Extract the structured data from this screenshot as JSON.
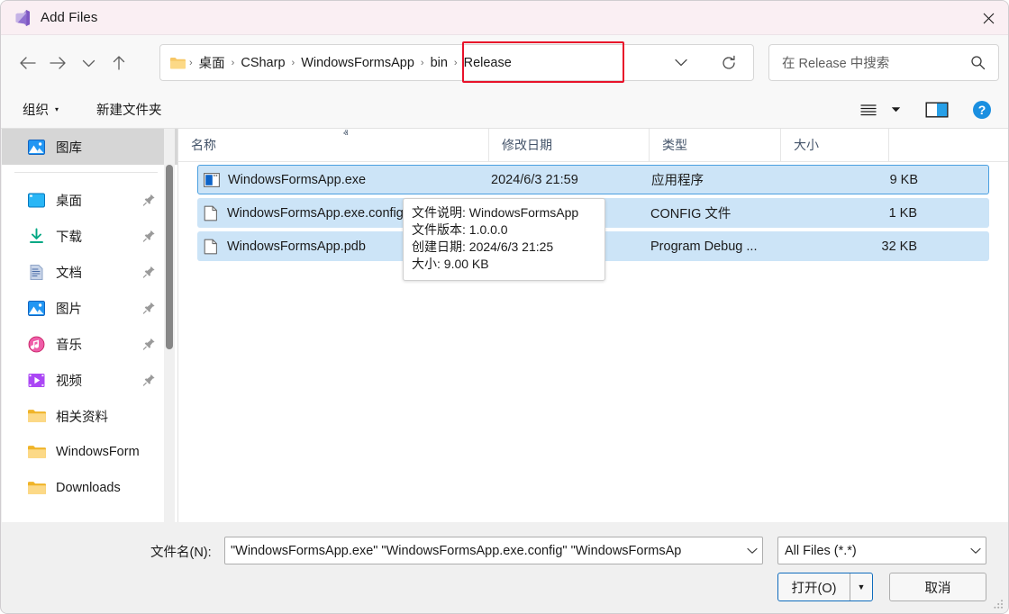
{
  "window": {
    "title": "Add Files",
    "app_icon": "visual-studio-icon",
    "close_label": "✕",
    "titlebar_color": "#faeff3"
  },
  "nav": {
    "back": "back-arrow-icon",
    "forward": "forward-arrow-icon",
    "recent": "chevron-down-icon",
    "up": "up-arrow-icon",
    "refresh": "refresh-icon",
    "dropdown": "chevron-down-icon"
  },
  "breadcrumb": {
    "folder_icon": "folder-icon",
    "separator": "›",
    "items": [
      "桌面",
      "CSharp",
      "WindowsFormsApp",
      "bin",
      "Release"
    ],
    "highlight_color": "#e8122a",
    "highlighted_items": [
      "bin",
      "Release"
    ]
  },
  "search": {
    "placeholder": "在 Release 中搜索",
    "icon": "search-icon"
  },
  "toolbar": {
    "organize_label": "组织",
    "organize_caret": "▾",
    "new_folder_label": "新建文件夹",
    "view_icon": "view-list-icon",
    "view_caret": "▾",
    "preview_pane_icon": "preview-pane-icon",
    "help_icon": "help-icon"
  },
  "sidebar": {
    "items": [
      {
        "label": "图库",
        "icon": "gallery-icon",
        "selected": true,
        "pinned": false
      },
      {
        "label": "桌面",
        "icon": "desktop-icon",
        "selected": false,
        "pinned": true
      },
      {
        "label": "下载",
        "icon": "downloads-icon",
        "selected": false,
        "pinned": true
      },
      {
        "label": "文档",
        "icon": "documents-icon",
        "selected": false,
        "pinned": true
      },
      {
        "label": "图片",
        "icon": "pictures-icon",
        "selected": false,
        "pinned": true
      },
      {
        "label": "音乐",
        "icon": "music-icon",
        "selected": false,
        "pinned": true
      },
      {
        "label": "视频",
        "icon": "videos-icon",
        "selected": false,
        "pinned": true
      },
      {
        "label": "相关资料",
        "icon": "folder-icon",
        "selected": false,
        "pinned": false
      },
      {
        "label": "WindowsForm",
        "icon": "folder-icon",
        "selected": false,
        "pinned": false
      },
      {
        "label": "Downloads",
        "icon": "folder-icon",
        "selected": false,
        "pinned": false
      }
    ]
  },
  "filelist": {
    "columns": [
      {
        "label": "名称",
        "sorted": "asc",
        "sort_caret": "ⱏ"
      },
      {
        "label": "修改日期",
        "sorted": ""
      },
      {
        "label": "类型",
        "sorted": ""
      },
      {
        "label": "大小",
        "sorted": ""
      }
    ],
    "rows": [
      {
        "name": "WindowsFormsApp.exe",
        "icon": "application-icon",
        "date": "2024/6/3 21:59",
        "type": "应用程序",
        "size": "9 KB",
        "selected": true,
        "focused": true
      },
      {
        "name": "WindowsFormsApp.exe.config",
        "icon": "file-icon",
        "date": "",
        "type": "CONFIG 文件",
        "size": "1 KB",
        "selected": true,
        "focused": false
      },
      {
        "name": "WindowsFormsApp.pdb",
        "icon": "file-icon",
        "date": "",
        "type": "Program Debug ...",
        "size": "32 KB",
        "selected": true,
        "focused": false
      }
    ],
    "selection_color": "#cce4f7"
  },
  "tooltip": {
    "lines": [
      "文件说明: WindowsFormsApp",
      "文件版本: 1.0.0.0",
      "创建日期: 2024/6/3 21:25",
      "大小: 9.00 KB"
    ]
  },
  "footer": {
    "filename_label": "文件名(N):",
    "filename_value": "\"WindowsFormsApp.exe\" \"WindowsFormsApp.exe.config\" \"WindowsFormsAp",
    "filename_chevron": "⌄",
    "filter_value": "All Files (*.*)",
    "filter_chevron": "⌄",
    "open_label": "打开(O)",
    "open_split_caret": "▼",
    "cancel_label": "取消",
    "accent_color": "#0f6cbd"
  }
}
